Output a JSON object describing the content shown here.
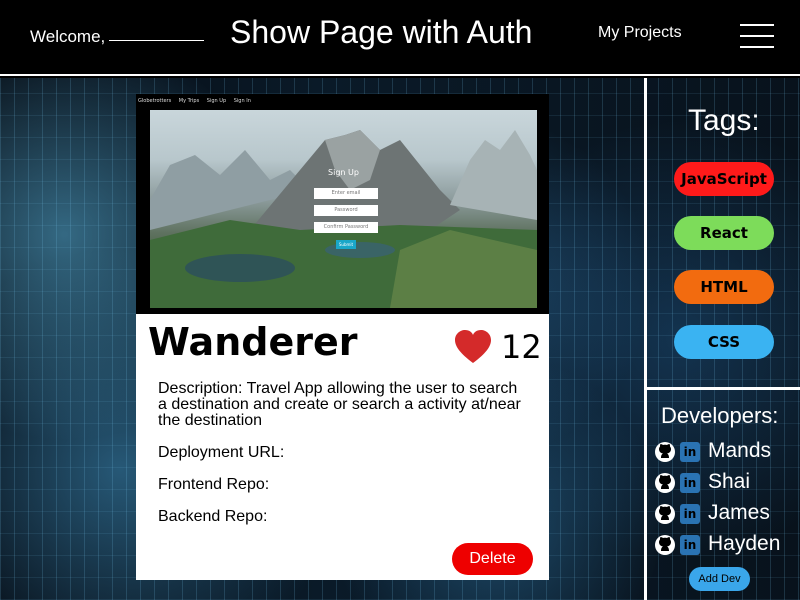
{
  "header": {
    "welcome_label": "Welcome,",
    "title": "Show Page with Auth",
    "nav_link": "My Projects",
    "menu_icon": "hamburger-menu-icon"
  },
  "preview": {
    "nav": [
      "Globetrotters",
      "My Trips",
      "Sign Up",
      "Sign In"
    ],
    "form_title": "Sign Up",
    "email_placeholder": "Enter email",
    "password_placeholder": "Password",
    "confirm_placeholder": "Confirm Password",
    "submit_label": "Submit"
  },
  "project": {
    "title": "Wanderer",
    "likes": "12",
    "heart_icon": "heart-icon",
    "description": "Description: Travel App allowing the user to search a destination and create or search a activity at/near the destination",
    "deployment_label": "Deployment URL:",
    "frontend_label": "Frontend Repo:",
    "backend_label": "Backend Repo:",
    "delete_label": "Delete"
  },
  "tags": {
    "title": "Tags:",
    "items": [
      {
        "label": "JavaScript",
        "color": "#ff1a1a"
      },
      {
        "label": "React",
        "color": "#7ddc5a"
      },
      {
        "label": "HTML",
        "color": "#f26b0f"
      },
      {
        "label": "CSS",
        "color": "#3ab3f2"
      }
    ]
  },
  "developers": {
    "title": "Developers:",
    "items": [
      {
        "name": "Mands"
      },
      {
        "name": "Shai"
      },
      {
        "name": "James"
      },
      {
        "name": "Hayden"
      }
    ],
    "add_label": "Add Dev",
    "github_icon": "github-icon",
    "linkedin_icon": "linkedin-icon",
    "linkedin_glyph": "in"
  }
}
